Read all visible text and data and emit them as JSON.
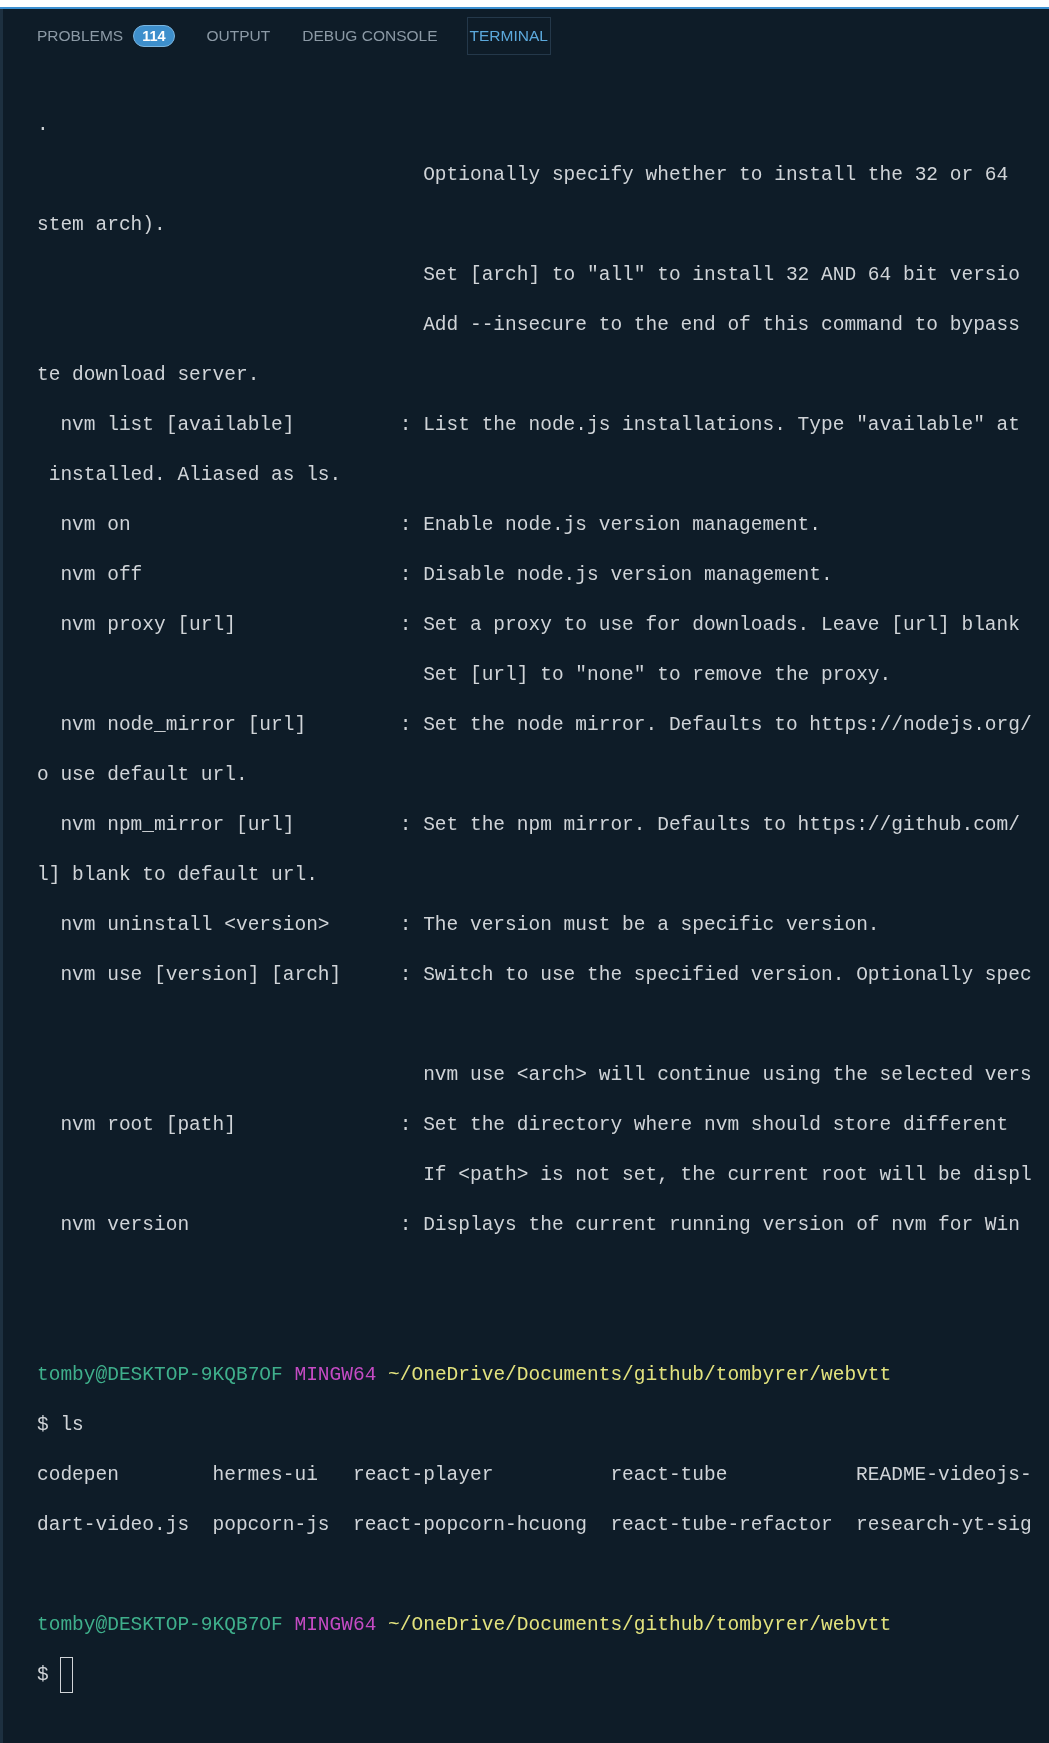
{
  "panel": {
    "tabs": [
      {
        "label": "PROBLEMS",
        "badge": "114",
        "selected": false
      },
      {
        "label": "OUTPUT",
        "selected": false
      },
      {
        "label": "DEBUG CONSOLE",
        "selected": false
      },
      {
        "label": "TERMINAL",
        "selected": true
      }
    ]
  },
  "terminal": {
    "lines": [
      {
        "kind": "text",
        "text": "."
      },
      {
        "kind": "text",
        "text": "                                 Optionally specify whether to install the 32 or 64"
      },
      {
        "kind": "text",
        "text": "stem arch)."
      },
      {
        "kind": "text",
        "text": "                                 Set [arch] to \"all\" to install 32 AND 64 bit versio"
      },
      {
        "kind": "text",
        "text": "                                 Add --insecure to the end of this command to bypass"
      },
      {
        "kind": "text",
        "text": "te download server."
      },
      {
        "kind": "text",
        "text": "  nvm list [available]         : List the node.js installations. Type \"available\" at"
      },
      {
        "kind": "text",
        "text": " installed. Aliased as ls."
      },
      {
        "kind": "text",
        "text": "  nvm on                       : Enable node.js version management."
      },
      {
        "kind": "text",
        "text": "  nvm off                      : Disable node.js version management."
      },
      {
        "kind": "text",
        "text": "  nvm proxy [url]              : Set a proxy to use for downloads. Leave [url] blank"
      },
      {
        "kind": "text",
        "text": "                                 Set [url] to \"none\" to remove the proxy."
      },
      {
        "kind": "text",
        "text": "  nvm node_mirror [url]        : Set the node mirror. Defaults to https://nodejs.org/"
      },
      {
        "kind": "text",
        "text": "o use default url."
      },
      {
        "kind": "text",
        "text": "  nvm npm_mirror [url]         : Set the npm mirror. Defaults to https://github.com/"
      },
      {
        "kind": "text",
        "text": "l] blank to default url."
      },
      {
        "kind": "text",
        "text": "  nvm uninstall <version>      : The version must be a specific version."
      },
      {
        "kind": "text",
        "text": "  nvm use [version] [arch]     : Switch to use the specified version. Optionally spec"
      },
      {
        "kind": "blank"
      },
      {
        "kind": "text",
        "text": "                                 nvm use <arch> will continue using the selected vers"
      },
      {
        "kind": "text",
        "text": "  nvm root [path]              : Set the directory where nvm should store different"
      },
      {
        "kind": "text",
        "text": "                                 If <path> is not set, the current root will be displ"
      },
      {
        "kind": "text",
        "text": "  nvm version                  : Displays the current running version of nvm for Win"
      },
      {
        "kind": "blank"
      },
      {
        "kind": "blank"
      },
      {
        "kind": "prompt",
        "user": "tomby@DESKTOP-9KQB7OF",
        "system": "MINGW64",
        "path": "~/OneDrive/Documents/github/tombyrer/webvtt"
      },
      {
        "kind": "text",
        "text": "$ ls"
      },
      {
        "kind": "files",
        "names": [
          "codepen",
          "hermes-ui",
          "react-player",
          "react-tube",
          "README-videojs-"
        ]
      },
      {
        "kind": "files",
        "names": [
          "dart-video.js",
          "popcorn-js",
          "react-popcorn-hcuong",
          "react-tube-refactor",
          "research-yt-sig"
        ]
      },
      {
        "kind": "blank"
      },
      {
        "kind": "prompt",
        "user": "tomby@DESKTOP-9KQB7OF",
        "system": "MINGW64",
        "path": "~/OneDrive/Documents/github/tombyrer/webvtt"
      },
      {
        "kind": "input",
        "prompt": "$",
        "cursor": true
      }
    ]
  }
}
